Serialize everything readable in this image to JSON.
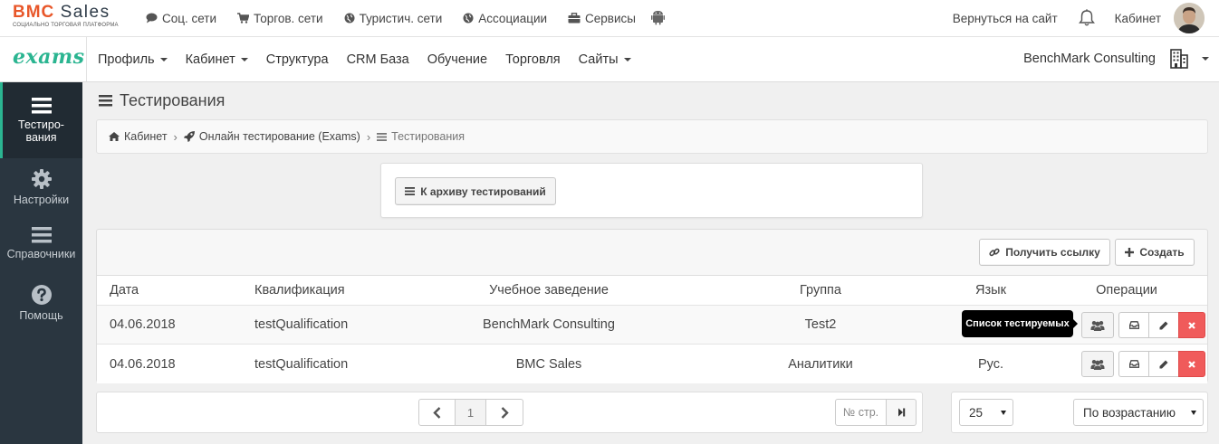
{
  "top": {
    "brand": {
      "name_part1": "BMC",
      "name_part2": "Sales",
      "subtitle": "СОЦИАЛЬНО ТОРГОВАЯ ПЛАТФОРМА"
    },
    "nav": [
      {
        "label": "Соц. сети",
        "icon": "chat-icon"
      },
      {
        "label": "Торгов. сети",
        "icon": "cart-icon"
      },
      {
        "label": "Туристич. сети",
        "icon": "globe-icon"
      },
      {
        "label": "Ассоциации",
        "icon": "globe-icon"
      },
      {
        "label": "Сервисы",
        "icon": "briefcase-icon"
      }
    ],
    "back_link": "Вернуться на сайт",
    "cabinet": "Кабинет"
  },
  "app_nav": {
    "logo": "exams",
    "items": [
      {
        "label": "Профиль",
        "dropdown": true
      },
      {
        "label": "Кабинет",
        "dropdown": true
      },
      {
        "label": "Структура",
        "dropdown": false
      },
      {
        "label": "CRM База",
        "dropdown": false
      },
      {
        "label": "Обучение",
        "dropdown": false
      },
      {
        "label": "Торговля",
        "dropdown": false
      },
      {
        "label": "Сайты",
        "dropdown": true
      }
    ],
    "company": "BenchMark Consulting"
  },
  "sidebar": {
    "items": [
      {
        "label_line1": "Тестиро-",
        "label_line2": "вания",
        "icon": "list-icon",
        "active": true
      },
      {
        "label": "Настройки",
        "icon": "gear-icon"
      },
      {
        "label": "Справочники",
        "icon": "list-icon"
      },
      {
        "label": "Помощь",
        "icon": "question-icon"
      }
    ]
  },
  "page": {
    "title": "Тестирования",
    "breadcrumb": [
      "Кабинет",
      "Онлайн тестирование (Exams)",
      "Тестирования"
    ],
    "archive_button": "К архиву тестирований",
    "get_link_button": "Получить ссылку",
    "create_button": "Создать"
  },
  "table": {
    "headers": [
      "Дата",
      "Квалификация",
      "Учебное заведение",
      "Группа",
      "Язык",
      "Операции"
    ],
    "rows": [
      {
        "date": "04.06.2018",
        "qualification": "testQualification",
        "institution": "BenchMark Consulting",
        "group": "Test2",
        "language": ""
      },
      {
        "date": "04.06.2018",
        "qualification": "testQualification",
        "institution": "BMC Sales",
        "group": "Аналитики",
        "language": "Рус."
      }
    ],
    "tooltip": "Список тестируемых"
  },
  "pagination": {
    "current_page": "1",
    "goto_placeholder": "№ стр.",
    "per_page": "25",
    "sort_order": "По возрастанию"
  },
  "colors": {
    "accent": "#2bb591",
    "brand_orange": "#e8572a",
    "sidebar_bg": "#2a3640",
    "delete_red": "#f05b5b"
  }
}
